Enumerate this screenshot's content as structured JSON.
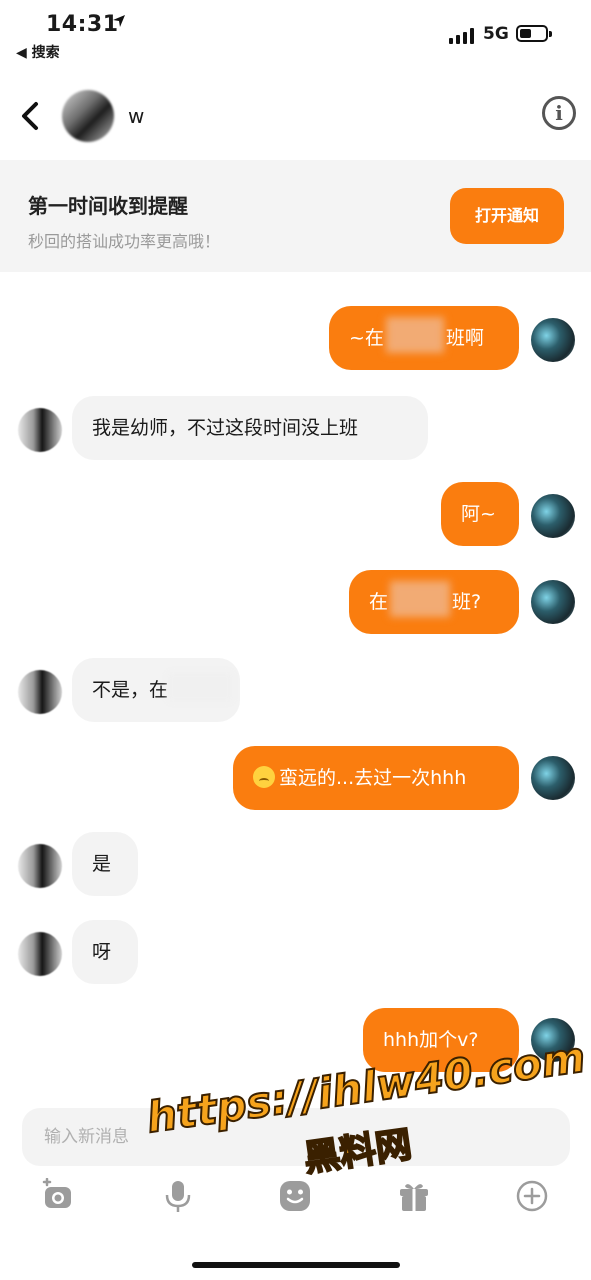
{
  "status_bar": {
    "time": "14:31",
    "back_app": "◀ 搜索",
    "network": "5G"
  },
  "header": {
    "contact_name": "w",
    "info_icon": "info-icon"
  },
  "notice": {
    "title": "第一时间收到提醒",
    "subtitle": "秒回的搭讪成功率更高哦！",
    "button": "打开通知"
  },
  "messages": [
    {
      "from": "me",
      "text_before": "~在",
      "text_after": "班啊"
    },
    {
      "from": "them",
      "text": "我是幼师，不过这段时间没上班"
    },
    {
      "from": "me",
      "text": "阿~"
    },
    {
      "from": "me",
      "text_before": "在",
      "text_after": "班?"
    },
    {
      "from": "them",
      "text": "不是，在"
    },
    {
      "from": "me",
      "text": "蛮远的...去过一次hhh"
    },
    {
      "from": "them",
      "text": "是"
    },
    {
      "from": "them",
      "text": "呀"
    },
    {
      "from": "me",
      "text": "hhh加个v?"
    }
  ],
  "composer": {
    "placeholder": "输入新消息"
  },
  "toolbar": [
    "camera-icon",
    "mic-icon",
    "emoji-icon",
    "gift-icon",
    "plus-icon"
  ],
  "watermark": {
    "url": "https://ihlw40.com",
    "text": "黑料网"
  },
  "colors": {
    "accent": "#fa7d0f",
    "incoming_bubble": "#f3f3f3",
    "banner_bg": "#f4f4f4"
  }
}
